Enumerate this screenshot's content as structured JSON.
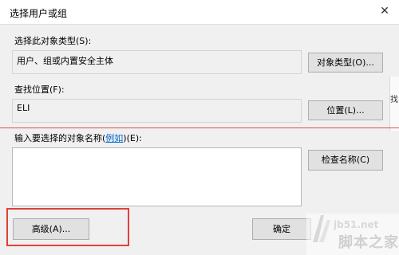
{
  "dialog": {
    "title": "选择用户或组",
    "close_glyph": "✕",
    "object_type": {
      "label": "选择此对象类型(S):",
      "value": "用户、组或内置安全主体",
      "button": "对象类型(O)..."
    },
    "location": {
      "label": "查找位置(F):",
      "value": "ELI",
      "button": "位置(L)..."
    },
    "names": {
      "label_prefix": "输入要选择的对象名称(",
      "label_link": "例如",
      "label_suffix": ")(E):",
      "value": "",
      "check_button": "检查名称(C)"
    },
    "advanced_button": "高级(A)...",
    "ok_button": "确定"
  },
  "background_window": {
    "text": "找"
  },
  "watermark": {
    "url": "jb51.net",
    "name": "脚本之家"
  },
  "colors": {
    "highlight": "#e0403a",
    "redline": "#e05050",
    "link": "#0066cc"
  }
}
